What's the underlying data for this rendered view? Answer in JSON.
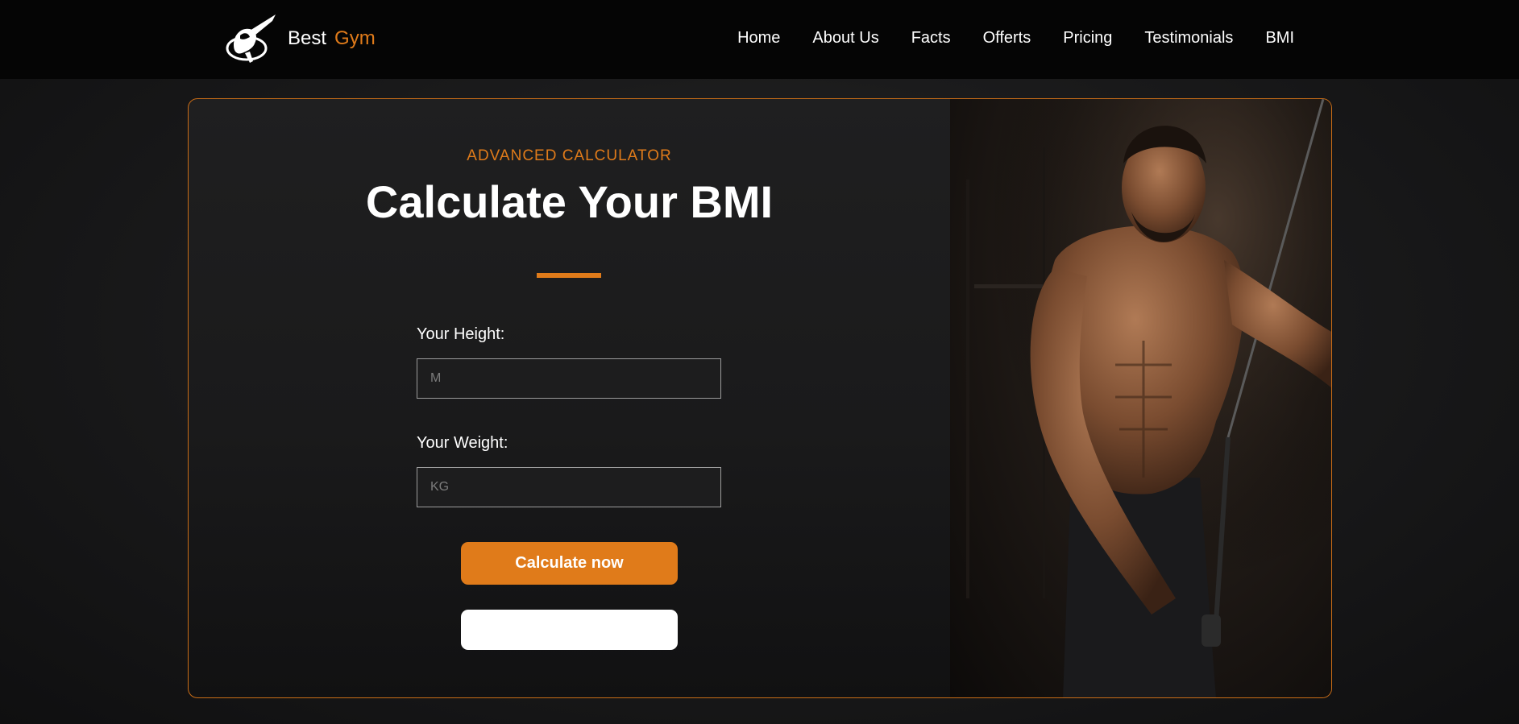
{
  "brand": {
    "first": "Best",
    "second": "Gym",
    "logo_icon": "gladiator-logo-icon"
  },
  "nav": {
    "items": [
      "Home",
      "About Us",
      "Facts",
      "Offerts",
      "Pricing",
      "Testimonials",
      "BMI"
    ]
  },
  "calculator": {
    "eyebrow": "ADVANCED CALCULATOR",
    "title": "Calculate Your BMI",
    "height": {
      "label": "Your Height:",
      "placeholder": "M",
      "value": ""
    },
    "weight": {
      "label": "Your Weight:",
      "placeholder": "KG",
      "value": ""
    },
    "submit_label": "Calculate now",
    "result": ""
  },
  "photo": {
    "subject": "muscular-athlete-photo"
  },
  "colors": {
    "accent": "#e07b1a",
    "navbar_bg": "#050505",
    "page_bg": "#1b1b1c",
    "text": "#ffffff"
  }
}
